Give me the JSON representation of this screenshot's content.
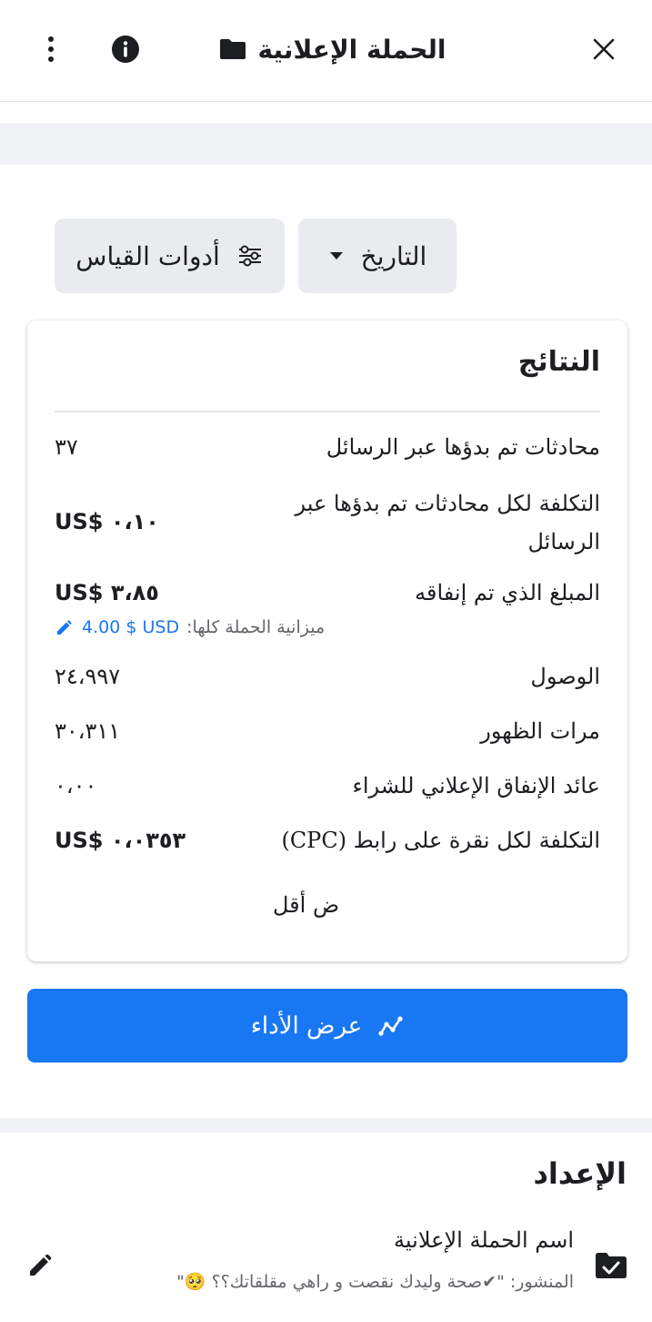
{
  "header": {
    "title": "الحملة الإعلانية"
  },
  "filters": {
    "date_label": "التاريخ",
    "metrics_label": "أدوات القياس"
  },
  "results": {
    "title": "النتائج",
    "rows": [
      {
        "label": "محادثات تم بدؤها عبر الرسائل",
        "value": "٣٧"
      },
      {
        "label": "التكلفة لكل محادثات تم بدؤها عبر الرسائل",
        "value": "US$ ٠،١٠"
      },
      {
        "label": "المبلغ الذي تم إنفاقه",
        "value": "US$ ٣،٨٥"
      },
      {
        "label": "الوصول",
        "value": "٢٤،٩٩٧"
      },
      {
        "label": "مرات الظهور",
        "value": "٣٠،٣١١"
      },
      {
        "label": "عائد الإنفاق الإعلاني للشراء",
        "value": "٠،٠٠"
      },
      {
        "label": "التكلفة لكل نقرة على رابط (CPC)",
        "value": "US$ ٠،٠٣٥٣"
      }
    ],
    "budget_label": "ميزانية الحملة كلها:",
    "budget_amount": "4.00 $ USD",
    "show_less": "ض أقل"
  },
  "performance_button": {
    "label": "عرض الأداء"
  },
  "setup": {
    "title": "الإعداد",
    "campaign_name_label": "اسم الحملة الإعلانية",
    "post_text": "المنشور: \"✔صحة وليدك نقصت و راهي مقلقاتك؟؟ 🥺\""
  },
  "colors": {
    "accent": "#1877f2",
    "text": "#1c1e21",
    "muted": "#65676b",
    "chip_bg": "#e9ebee"
  },
  "icons": [
    "close-icon",
    "folder-icon",
    "info-icon",
    "more-vert-icon",
    "caret-down-icon",
    "sliders-icon",
    "pencil-icon",
    "chart-icon",
    "folder-check-icon"
  ]
}
